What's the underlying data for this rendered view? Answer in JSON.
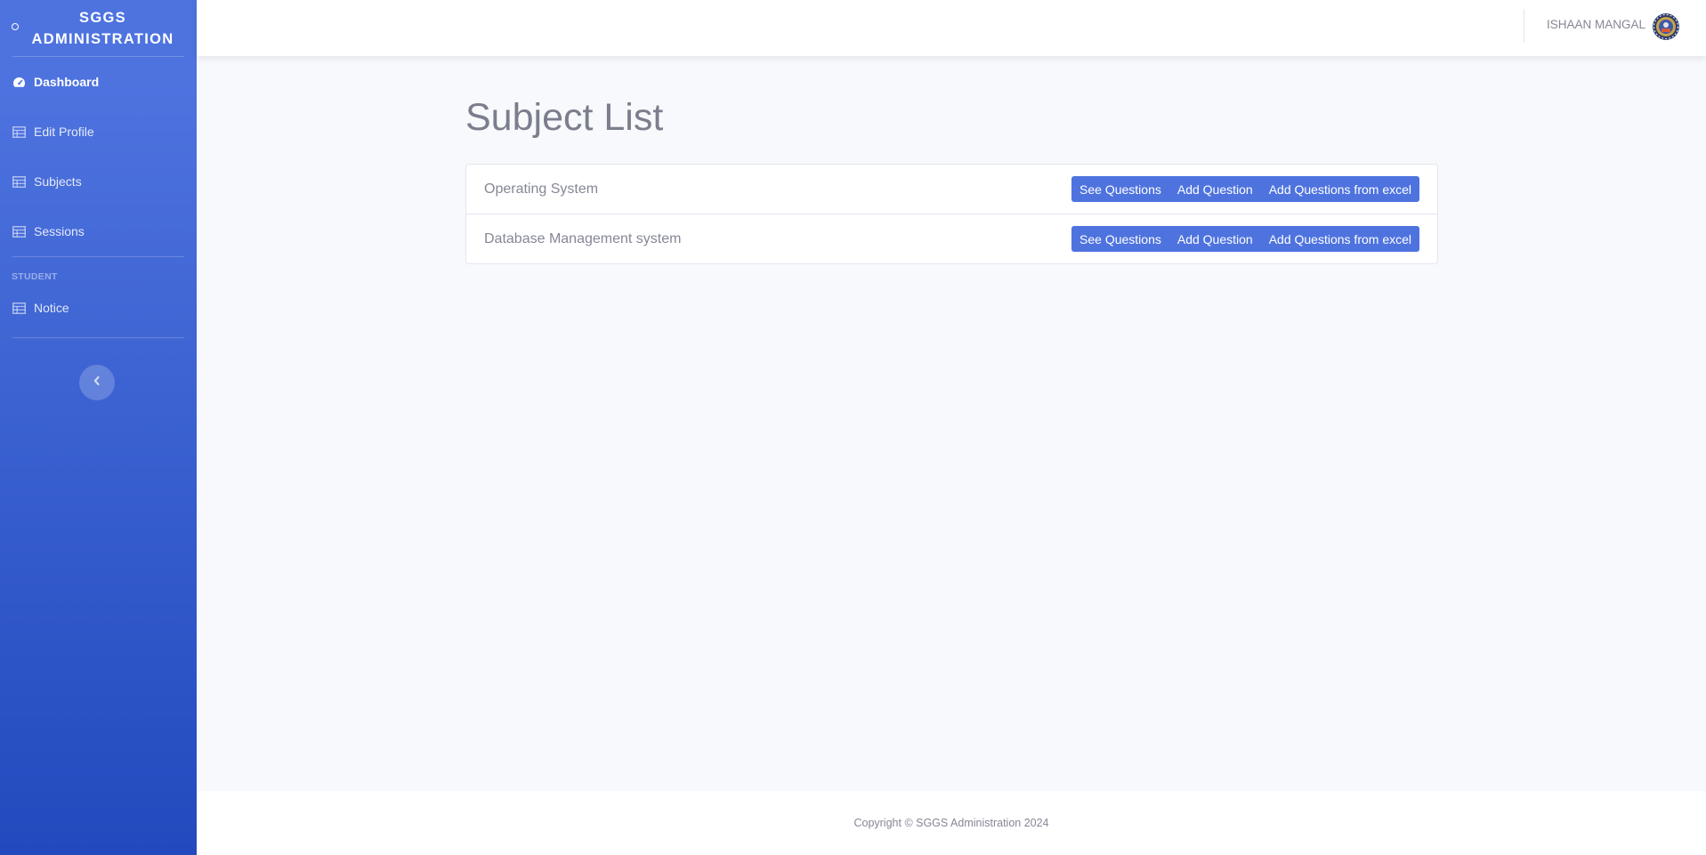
{
  "sidebar": {
    "brand": "SGGS ADMINISTRATION",
    "items": [
      {
        "label": "Dashboard",
        "icon": "tachometer-icon",
        "active": true
      },
      {
        "label": "Edit Profile",
        "icon": "table-icon"
      },
      {
        "label": "Subjects",
        "icon": "table-icon"
      },
      {
        "label": "Sessions",
        "icon": "table-icon"
      }
    ],
    "heading": "STUDENT",
    "student_items": [
      {
        "label": "Notice",
        "icon": "table-icon"
      }
    ],
    "toggle_icon": "chevron-left-icon"
  },
  "topbar": {
    "user_name": "ISHAAN MANGAL"
  },
  "main": {
    "title": "Subject List",
    "subjects": [
      {
        "name": "Operating System"
      },
      {
        "name": "Database Management system"
      }
    ],
    "actions": {
      "see": "See Questions",
      "add": "Add Question",
      "excel": "Add Questions from excel"
    }
  },
  "footer": {
    "copyright": "Copyright © SGGS Administration 2024"
  },
  "colors": {
    "primary": "#4e73df",
    "sidebar_gradient_end": "#224abe",
    "text_muted": "#858796",
    "background": "#f8f9fc"
  }
}
